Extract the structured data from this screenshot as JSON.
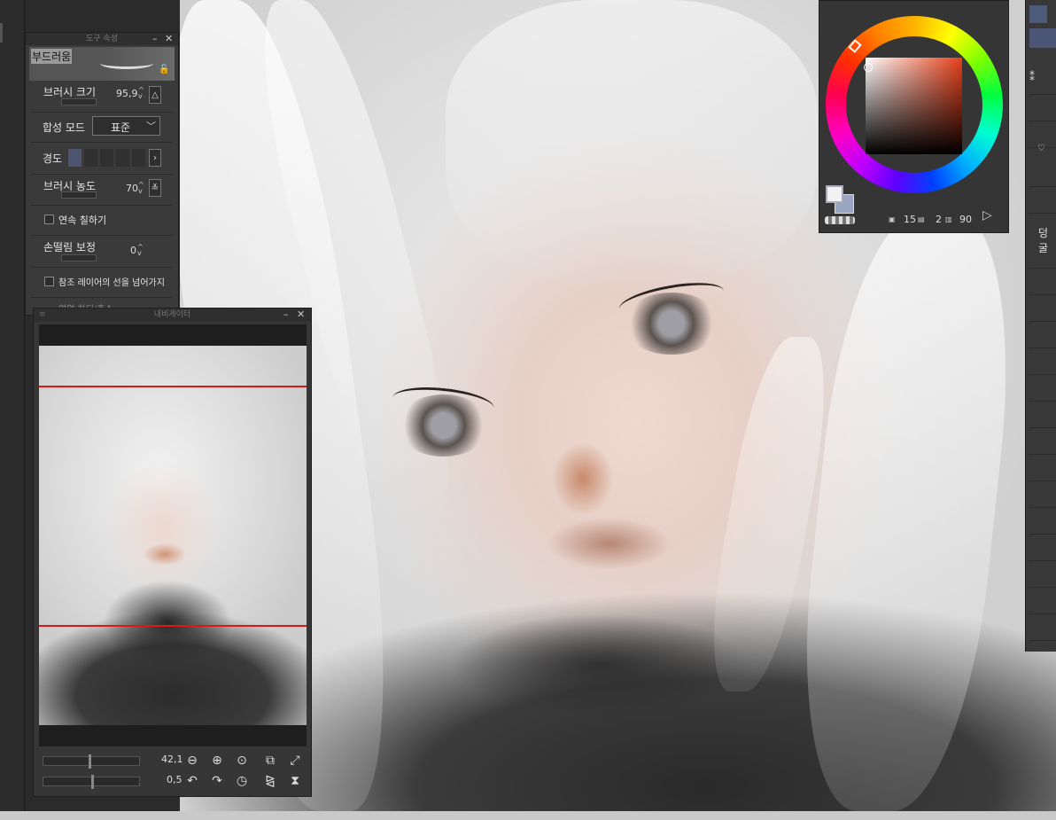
{
  "tool_property": {
    "title": "도구 속성",
    "brush_name": "부드러움",
    "brush_size_label": "브러시 크기",
    "brush_size_value": "95,9",
    "blend_mode_label": "합성 모드",
    "blend_mode_value": "표준",
    "hardness_label": "경도",
    "density_label": "브러시 농도",
    "density_value": "70",
    "continuous_label": "연속 칠하기",
    "stabilization_label": "손떨림 보정",
    "stabilization_value": "0",
    "ref_layer_label": "참조 레이어의 선을 넘어가지",
    "partial_label": "연영 하디/축소"
  },
  "navigator": {
    "title": "내비게이터",
    "zoom_value": "42,1",
    "rotate_value": "0,5"
  },
  "color_panel": {
    "value_a": "15",
    "value_b": "2",
    "value_c": "90"
  },
  "right_strip": {
    "label": "덩굴"
  },
  "colors": {
    "accent_red": "#e01515",
    "panel_bg": "#3a3a3a",
    "selected_color": "#e8401a"
  }
}
